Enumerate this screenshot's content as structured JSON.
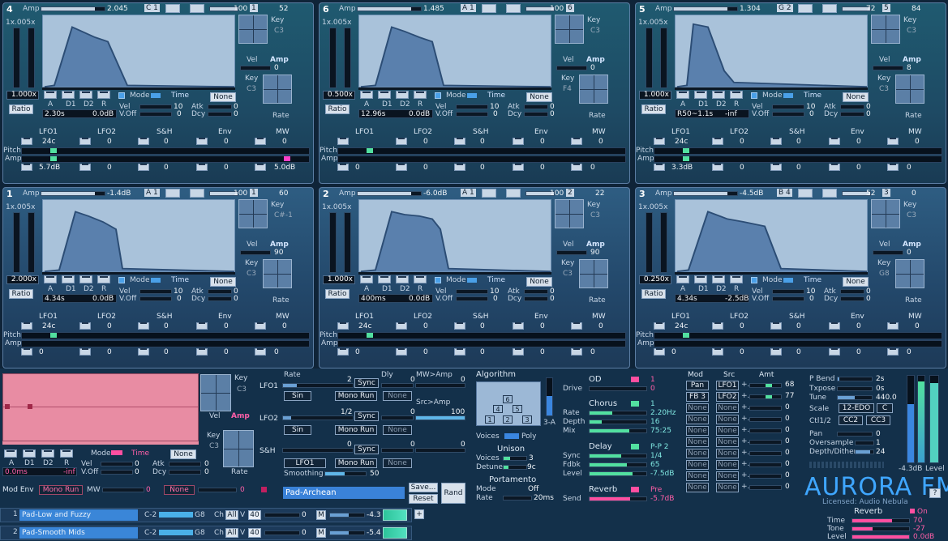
{
  "panels": [
    {
      "id": "4",
      "amp": "2.045",
      "key_note": "C 1",
      "level": "100",
      "ch": "1",
      "vel_box": "52",
      "env_left": "1x.005x",
      "scale": "1.000x",
      "times": "2.30s",
      "ampdb": "0.0dB",
      "keyc": "C3",
      "keyc2": "C3",
      "lfo1_rate": "24c",
      "lfo1_amt": "5.7dB",
      "mw_amt": "5.0dB",
      "rate_val": "0",
      "amp_val": "0"
    },
    {
      "id": "6",
      "amp": "1.485",
      "key_note": "A 1",
      "level": "100",
      "ch": "6",
      "vel_box": "",
      "env_left": "1x.005x",
      "scale": "0.500x",
      "times": "12.96s",
      "ampdb": "0.0dB",
      "keyc": "C3",
      "keyc2": "F4",
      "lfo1_rate": "",
      "lfo1_amt": "0",
      "mw_amt": "0",
      "rate_val": "0",
      "amp_val": "0"
    },
    {
      "id": "5",
      "amp": "1.304",
      "key_note": "G 2",
      "level": "72",
      "ch": "5",
      "vel_box": "84",
      "env_left": "1x.005x",
      "scale": "1.000x",
      "times": "R50~1.1s",
      "ampdb": "-inf",
      "keyc": "C3",
      "keyc2": "C3",
      "lfo1_rate": "24c",
      "lfo1_amt": "3.3dB",
      "mw_amt": "0",
      "rate_val": "0",
      "amp_val": "8"
    },
    {
      "id": "1",
      "amp": "-1.4dB",
      "key_note": "A 1",
      "level": "100",
      "ch": "1",
      "vel_box": "60",
      "env_left": "1x.005x",
      "scale": "2.000x",
      "times": "4.34s",
      "ampdb": "0.0dB",
      "keyc": "C#-1",
      "keyc2": "C3",
      "lfo1_rate": "24c",
      "lfo1_amt": "0",
      "mw_amt": "0",
      "rate_val": "0",
      "amp_val": "90"
    },
    {
      "id": "2",
      "amp": "-6.0dB",
      "key_note": "A 1",
      "level": "100",
      "ch": "2",
      "vel_box": "22",
      "env_left": "1x.005x",
      "scale": "1.000x",
      "times": "400ms",
      "ampdb": "0.0dB",
      "keyc": "C3",
      "keyc2": "C3",
      "lfo1_rate": "24c",
      "lfo1_amt": "0",
      "mw_amt": "0",
      "rate_val": "0",
      "amp_val": "90"
    },
    {
      "id": "3",
      "amp": "-4.5dB",
      "key_note": "B 4",
      "level": "52",
      "ch": "3",
      "vel_box": "0",
      "env_left": "1x.005x",
      "scale": "0.250x",
      "times": "4.34s",
      "ampdb": "-2.5dB",
      "keyc": "C3",
      "keyc2": "G8",
      "lfo1_rate": "24c",
      "lfo1_amt": "0",
      "mw_amt": "0",
      "rate_val": "0",
      "amp_val": "0"
    }
  ],
  "common": {
    "amp": "Amp",
    "key": "Key",
    "vel": "Vel",
    "amp_lbl": "Amp",
    "rate": "Rate",
    "ratio": "Ratio",
    "mode": "Mode",
    "time": "Time",
    "none": "None",
    "a": "A",
    "d1": "D1",
    "d2": "D2",
    "r": "R",
    "vel2": "Vel",
    "voff": "V.Off",
    "atk": "Atk",
    "dcy": "Dcy",
    "ten": "10",
    "zero": "0",
    "lfo1": "LFO1",
    "lfo2": "LFO2",
    "sh": "S&H",
    "env": "Env",
    "mw": "MW",
    "pitch": "Pitch",
    "ampl": "Amp"
  },
  "bottom": {
    "ratio_time": "0.0ms",
    "ratio_db": "-inf",
    "key_c": "C3",
    "key_c2": "C3",
    "mode": "Mode",
    "time": "Time",
    "none": "None",
    "mod_env": "Mod Env",
    "mono_run": "Mono Run",
    "mw": "MW",
    "mw_val": "0",
    "none2": "None",
    "none2_val": "0",
    "lfo1": "LFO1",
    "lfo2": "LFO2",
    "sh": "S&H",
    "rate": "Rate",
    "dly": "Dly",
    "mwamp": "MW>Amp",
    "srcamp": "Src>Amp",
    "lfo1_rate": "2",
    "lfo1_dly": "0",
    "lfo1_mwamp": "0",
    "lfo1_sync": "Sync",
    "lfo1_shape": "Sin",
    "lfo1_mono": "Mono Run",
    "lfo1_none": "None",
    "lfo2_rate": "1/2",
    "lfo2_dly": "0",
    "lfo2_src": "100",
    "lfo2_sync": "Sync",
    "lfo2_shape": "Sin",
    "lfo2_mono": "Mono Run",
    "lfo2_none": "None",
    "sh_rate": "0",
    "sh_dly": "0",
    "sh_val": "0",
    "sh_sync": "Sync",
    "sh_src": "LFO1",
    "sh_mono": "Mono Run",
    "sh_none": "None",
    "smoothing": "Smoothing",
    "smoothing_val": "50",
    "preset": "Pad-Archean",
    "save": "Save...",
    "reset": "Reset",
    "rand": "Rand",
    "algorithm": "Algorithm",
    "alg_id": "3-A",
    "voices": "Voices",
    "poly": "Poly",
    "unison": "Unison",
    "uni_voices": "Voices",
    "uni_voices_val": "3",
    "detune": "Detune",
    "detune_val": "9c",
    "portamento": "Portamento",
    "port_mode": "Mode",
    "port_mode_val": "Off",
    "port_rate": "Rate",
    "port_rate_val": "20ms",
    "od": "OD",
    "drive": "Drive",
    "od_v1": "1",
    "od_v2": "0",
    "chorus": "Chorus",
    "ch_rate": "Rate",
    "ch_depth": "Depth",
    "ch_mix": "Mix",
    "ch_v1": "1",
    "ch_v2": "2.20Hz",
    "ch_v3": "16",
    "ch_v4": "75:25",
    "delay": "Delay",
    "dl_sync": "Sync",
    "dl_fdbk": "Fdbk",
    "dl_level": "Level",
    "dl_v1": "P-P 2",
    "dl_v2": "1/4",
    "dl_v3": "65",
    "dl_v4": "-7.5dB",
    "rev_send": "Send",
    "reverb": "Reverb",
    "pre": "Pre",
    "rev_send_val": "-5.7dB",
    "mod": "Mod",
    "src": "Src",
    "amt": "Amt",
    "mods": [
      {
        "d": "Pan",
        "s": "LFO1",
        "v": "68"
      },
      {
        "d": "FB 3",
        "s": "LFO2",
        "v": "77"
      },
      {
        "d": "None",
        "s": "None",
        "v": "0"
      },
      {
        "d": "None",
        "s": "None",
        "v": "0"
      },
      {
        "d": "None",
        "s": "None",
        "v": "0"
      },
      {
        "d": "None",
        "s": "None",
        "v": "0"
      },
      {
        "d": "None",
        "s": "None",
        "v": "0"
      },
      {
        "d": "None",
        "s": "None",
        "v": "0"
      },
      {
        "d": "None",
        "s": "None",
        "v": "0"
      },
      {
        "d": "None",
        "s": "None",
        "v": "0"
      }
    ],
    "pbend": "P Bend",
    "pbend_val": "2s",
    "txpose": "Txpose",
    "txpose_val": "0s",
    "tune": "Tune",
    "tune_val": "440.0",
    "scale": "Scale",
    "scale_val": "12-EDO",
    "scale_c": "C",
    "ctl": "Ctl1/2",
    "cc2": "CC2",
    "cc3": "CC3",
    "pan": "Pan",
    "pan_val": "0",
    "oversample": "Oversample",
    "oversample_val": "1",
    "depth": "Depth/Dither",
    "depth_val": "24",
    "level_db": "-4.3dB",
    "level": "Level",
    "logo": "AURORA FM",
    "licensed": "Licensed: Audio Nebula",
    "help": "?",
    "rev2": "Reverb",
    "rev_on": "On",
    "rev_time": "Time",
    "rev_time_v": "70",
    "rev_tone": "Tone",
    "rev_tone_v": "-27",
    "rev_level": "Level",
    "rev_level_v": "0.0dB",
    "tracks": [
      {
        "n": "1",
        "name": "Pad-Low and Fuzzy",
        "lo": "C-2",
        "hi": "G8",
        "ch": "Ch",
        "all": "All",
        "v": "V",
        "vv": "40",
        "val": "0",
        "m": "M",
        "db": "-4.3"
      },
      {
        "n": "2",
        "name": "Pad-Smooth Mids",
        "lo": "C-2",
        "hi": "G8",
        "ch": "Ch",
        "all": "All",
        "v": "V",
        "vv": "40",
        "val": "0",
        "m": "M",
        "db": "-5.4"
      }
    ],
    "plus": "+"
  }
}
